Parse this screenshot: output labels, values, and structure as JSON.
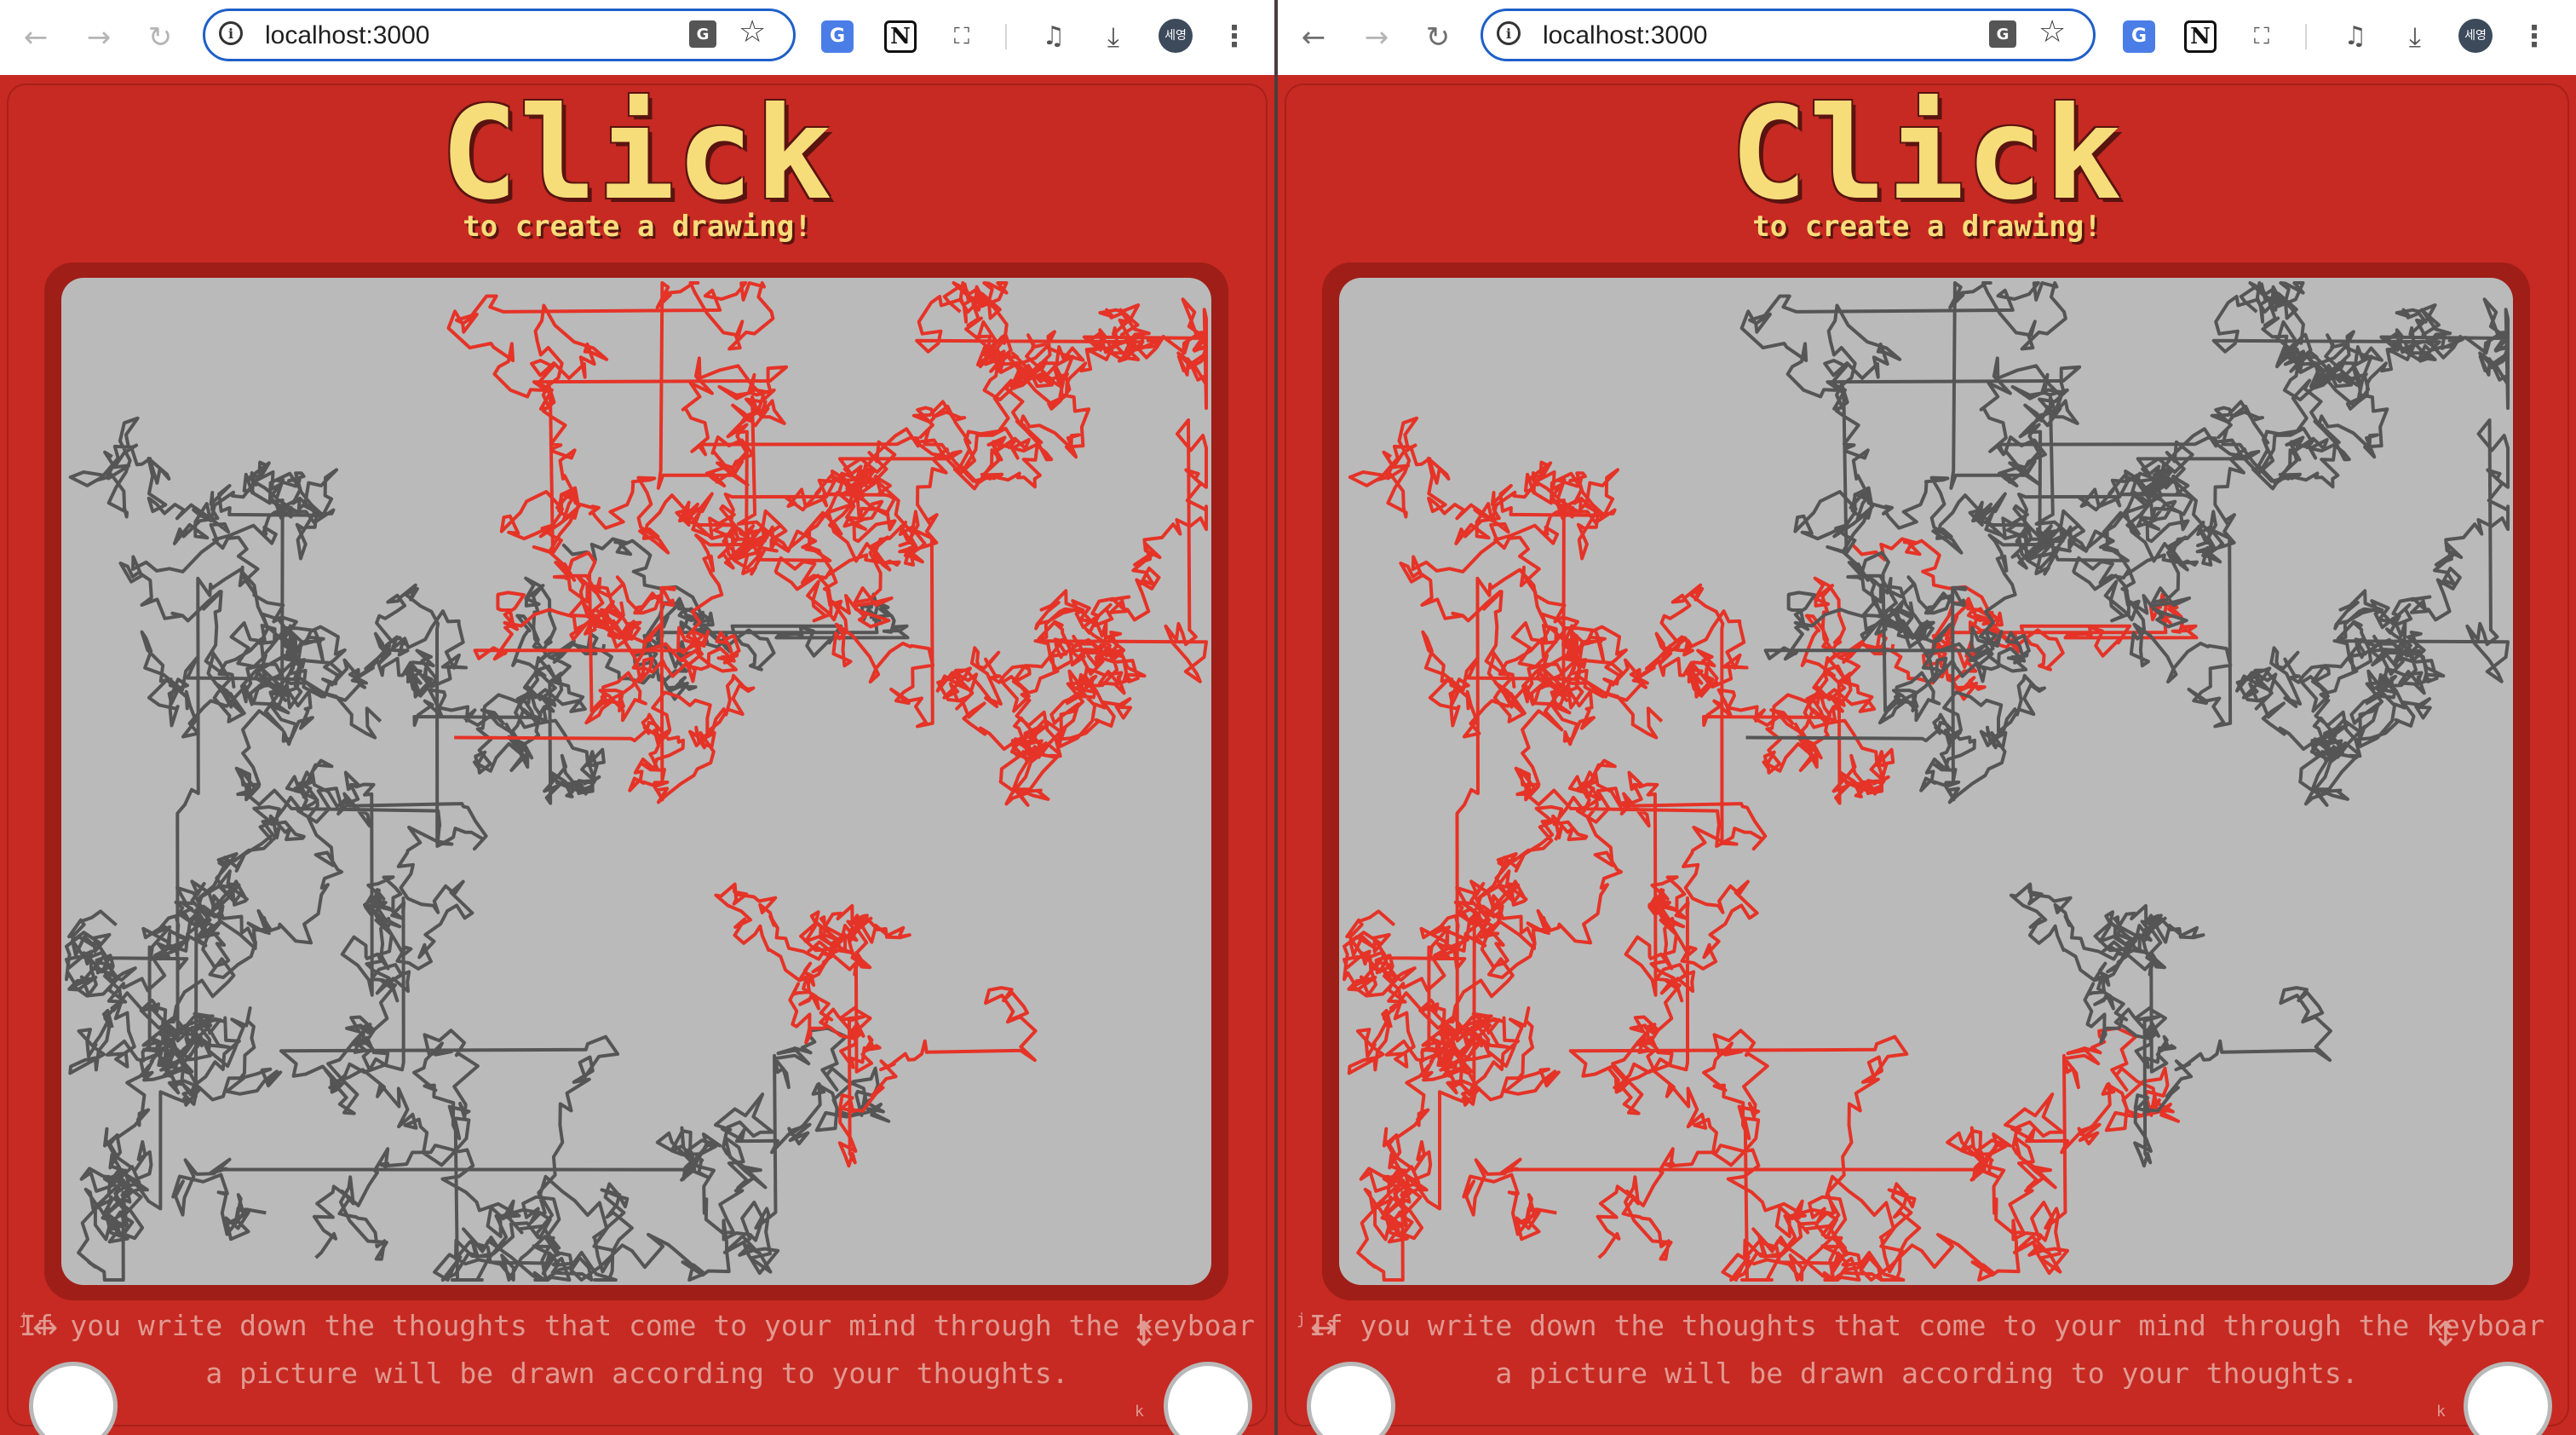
{
  "windows": [
    {
      "id": "left",
      "url": "localhost:3000",
      "primary_color": "#555555",
      "secondary_color": "#e53327"
    },
    {
      "id": "right",
      "url": "localhost:3000",
      "primary_color": "#e53327",
      "secondary_color": "#555555"
    }
  ],
  "toolbar": {
    "back_icon": "back-arrow-icon",
    "forward_icon": "forward-arrow-icon",
    "reload_icon": "reload-icon",
    "translate_badge": "G",
    "avatar_label": "세영"
  },
  "app": {
    "title": "Click",
    "subtitle": "to create a drawing!",
    "instructions_line1": "If you write down the thoughts that come to your mind through the keyboar",
    "instructions_line2": "a picture will be drawn according to your thoughts.",
    "left_knob_hint": "j",
    "right_knob_hint": "k"
  },
  "colors": {
    "body_red": "#c62a22",
    "screen_grey": "#bababa",
    "title_yellow": "#f7dd7a",
    "line_grey": "#555555",
    "line_red": "#e53327"
  }
}
